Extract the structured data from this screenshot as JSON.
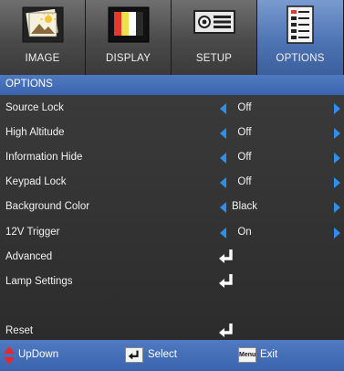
{
  "tabs": [
    {
      "label": "IMAGE",
      "icon": "image-icon",
      "active": false
    },
    {
      "label": "DISPLAY",
      "icon": "display-icon",
      "active": false
    },
    {
      "label": "SETUP",
      "icon": "setup-icon",
      "active": false
    },
    {
      "label": "OPTIONS",
      "icon": "options-icon",
      "active": true
    }
  ],
  "header": {
    "title": "OPTIONS"
  },
  "rows": [
    {
      "label": "Source Lock",
      "value": "Off",
      "type": "select"
    },
    {
      "label": "High Altitude",
      "value": "Off",
      "type": "select"
    },
    {
      "label": "Information Hide",
      "value": "Off",
      "type": "select"
    },
    {
      "label": "Keypad Lock",
      "value": "Off",
      "type": "select"
    },
    {
      "label": "Background Color",
      "value": "Black",
      "type": "select"
    },
    {
      "label": "12V Trigger",
      "value": "On",
      "type": "select"
    },
    {
      "label": "Advanced",
      "type": "enter"
    },
    {
      "label": "Lamp Settings",
      "type": "enter"
    },
    {
      "label": "Reset",
      "type": "enter"
    }
  ],
  "footer": {
    "updown": "UpDown",
    "select": "Select",
    "menu_key": "Menu",
    "exit": "Exit"
  },
  "colors": {
    "accent": "#3a64ad",
    "arrow": "#2f8ff0",
    "active_tab": "#4f74b4"
  }
}
